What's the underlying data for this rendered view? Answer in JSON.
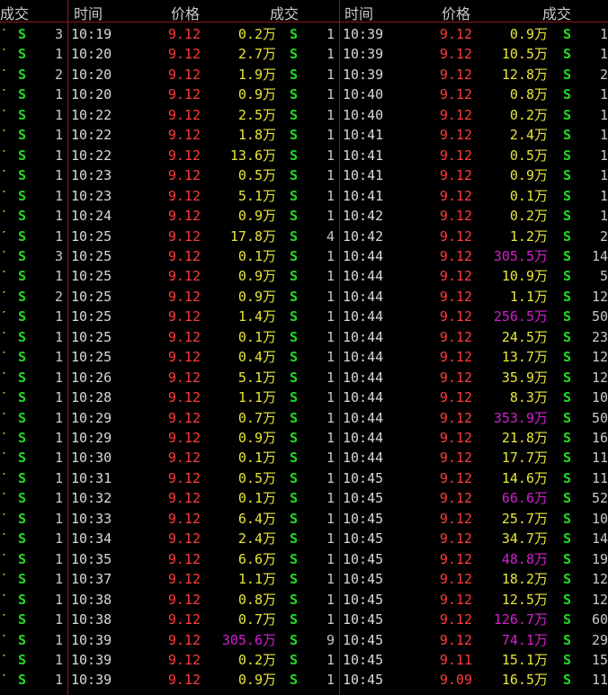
{
  "header": {
    "col0_trade": "成交",
    "left": {
      "time": "时间",
      "price": "价格",
      "trade": "成交"
    },
    "right": {
      "time": "时间",
      "price": "价格",
      "trade": "成交"
    }
  },
  "col0": [
    {
      "n": "3"
    },
    {
      "n": "1"
    },
    {
      "n": "2"
    },
    {
      "n": "1"
    },
    {
      "n": "1"
    },
    {
      "n": "1"
    },
    {
      "n": "1"
    },
    {
      "n": "1"
    },
    {
      "n": "1"
    },
    {
      "n": "1"
    },
    {
      "n": "1"
    },
    {
      "n": "3"
    },
    {
      "n": "1"
    },
    {
      "n": "2"
    },
    {
      "n": "1"
    },
    {
      "n": "1"
    },
    {
      "n": "1"
    },
    {
      "n": "1"
    },
    {
      "n": "1"
    },
    {
      "n": "1"
    },
    {
      "n": "1"
    },
    {
      "n": "1"
    },
    {
      "n": "1"
    },
    {
      "n": "1"
    },
    {
      "n": "1"
    },
    {
      "n": "1"
    },
    {
      "n": "1"
    },
    {
      "n": "1"
    },
    {
      "n": "1"
    },
    {
      "n": "1"
    },
    {
      "n": "1"
    },
    {
      "n": "1"
    },
    {
      "n": "1"
    }
  ],
  "left": [
    {
      "time": "10:19",
      "price": "9.12",
      "vol": "0.2万",
      "s": "S",
      "n": "1"
    },
    {
      "time": "10:20",
      "price": "9.12",
      "vol": "2.7万",
      "s": "S",
      "n": "1"
    },
    {
      "time": "10:20",
      "price": "9.12",
      "vol": "1.9万",
      "s": "S",
      "n": "1"
    },
    {
      "time": "10:20",
      "price": "9.12",
      "vol": "0.9万",
      "s": "S",
      "n": "1"
    },
    {
      "time": "10:22",
      "price": "9.12",
      "vol": "2.5万",
      "s": "S",
      "n": "1"
    },
    {
      "time": "10:22",
      "price": "9.12",
      "vol": "1.8万",
      "s": "S",
      "n": "1"
    },
    {
      "time": "10:22",
      "price": "9.12",
      "vol": "13.6万",
      "s": "S",
      "n": "1"
    },
    {
      "time": "10:23",
      "price": "9.12",
      "vol": "0.5万",
      "s": "S",
      "n": "1"
    },
    {
      "time": "10:23",
      "price": "9.12",
      "vol": "5.1万",
      "s": "S",
      "n": "1"
    },
    {
      "time": "10:24",
      "price": "9.12",
      "vol": "0.9万",
      "s": "S",
      "n": "1"
    },
    {
      "time": "10:25",
      "price": "9.12",
      "vol": "17.8万",
      "s": "S",
      "n": "4"
    },
    {
      "time": "10:25",
      "price": "9.12",
      "vol": "0.1万",
      "s": "S",
      "n": "1"
    },
    {
      "time": "10:25",
      "price": "9.12",
      "vol": "0.9万",
      "s": "S",
      "n": "1"
    },
    {
      "time": "10:25",
      "price": "9.12",
      "vol": "0.9万",
      "s": "S",
      "n": "1"
    },
    {
      "time": "10:25",
      "price": "9.12",
      "vol": "1.4万",
      "s": "S",
      "n": "1"
    },
    {
      "time": "10:25",
      "price": "9.12",
      "vol": "0.1万",
      "s": "S",
      "n": "1"
    },
    {
      "time": "10:25",
      "price": "9.12",
      "vol": "0.4万",
      "s": "S",
      "n": "1"
    },
    {
      "time": "10:26",
      "price": "9.12",
      "vol": "5.1万",
      "s": "S",
      "n": "1"
    },
    {
      "time": "10:28",
      "price": "9.12",
      "vol": "1.1万",
      "s": "S",
      "n": "1"
    },
    {
      "time": "10:29",
      "price": "9.12",
      "vol": "0.7万",
      "s": "S",
      "n": "1"
    },
    {
      "time": "10:29",
      "price": "9.12",
      "vol": "0.9万",
      "s": "S",
      "n": "1"
    },
    {
      "time": "10:30",
      "price": "9.12",
      "vol": "0.1万",
      "s": "S",
      "n": "1"
    },
    {
      "time": "10:31",
      "price": "9.12",
      "vol": "0.5万",
      "s": "S",
      "n": "1"
    },
    {
      "time": "10:32",
      "price": "9.12",
      "vol": "0.1万",
      "s": "S",
      "n": "1"
    },
    {
      "time": "10:33",
      "price": "9.12",
      "vol": "6.4万",
      "s": "S",
      "n": "1"
    },
    {
      "time": "10:34",
      "price": "9.12",
      "vol": "2.4万",
      "s": "S",
      "n": "1"
    },
    {
      "time": "10:35",
      "price": "9.12",
      "vol": "6.6万",
      "s": "S",
      "n": "1"
    },
    {
      "time": "10:37",
      "price": "9.12",
      "vol": "1.1万",
      "s": "S",
      "n": "1"
    },
    {
      "time": "10:38",
      "price": "9.12",
      "vol": "0.8万",
      "s": "S",
      "n": "1"
    },
    {
      "time": "10:38",
      "price": "9.12",
      "vol": "0.7万",
      "s": "S",
      "n": "1"
    },
    {
      "time": "10:39",
      "price": "9.12",
      "vol": "305.6万",
      "s": "S",
      "n": "9",
      "big": true
    },
    {
      "time": "10:39",
      "price": "9.12",
      "vol": "0.2万",
      "s": "S",
      "n": "1"
    },
    {
      "time": "10:39",
      "price": "9.12",
      "vol": "0.9万",
      "s": "S",
      "n": "1"
    }
  ],
  "right": [
    {
      "time": "10:39",
      "price": "9.12",
      "vol": "0.9万",
      "s": "S",
      "n": "1"
    },
    {
      "time": "10:39",
      "price": "9.12",
      "vol": "10.5万",
      "s": "S",
      "n": "1"
    },
    {
      "time": "10:39",
      "price": "9.12",
      "vol": "12.8万",
      "s": "S",
      "n": "2"
    },
    {
      "time": "10:40",
      "price": "9.12",
      "vol": "0.8万",
      "s": "S",
      "n": "1"
    },
    {
      "time": "10:40",
      "price": "9.12",
      "vol": "0.2万",
      "s": "S",
      "n": "1"
    },
    {
      "time": "10:41",
      "price": "9.12",
      "vol": "2.4万",
      "s": "S",
      "n": "1"
    },
    {
      "time": "10:41",
      "price": "9.12",
      "vol": "0.5万",
      "s": "S",
      "n": "1"
    },
    {
      "time": "10:41",
      "price": "9.12",
      "vol": "0.9万",
      "s": "S",
      "n": "1"
    },
    {
      "time": "10:41",
      "price": "9.12",
      "vol": "0.1万",
      "s": "S",
      "n": "1"
    },
    {
      "time": "10:42",
      "price": "9.12",
      "vol": "0.2万",
      "s": "S",
      "n": "1"
    },
    {
      "time": "10:42",
      "price": "9.12",
      "vol": "1.2万",
      "s": "S",
      "n": "2"
    },
    {
      "time": "10:44",
      "price": "9.12",
      "vol": "305.5万",
      "s": "S",
      "n": "14",
      "big": true
    },
    {
      "time": "10:44",
      "price": "9.12",
      "vol": "10.9万",
      "s": "S",
      "n": "5"
    },
    {
      "time": "10:44",
      "price": "9.12",
      "vol": "1.1万",
      "s": "S",
      "n": "12"
    },
    {
      "time": "10:44",
      "price": "9.12",
      "vol": "256.5万",
      "s": "S",
      "n": "50",
      "big": true
    },
    {
      "time": "10:44",
      "price": "9.12",
      "vol": "24.5万",
      "s": "S",
      "n": "23"
    },
    {
      "time": "10:44",
      "price": "9.12",
      "vol": "13.7万",
      "s": "S",
      "n": "12"
    },
    {
      "time": "10:44",
      "price": "9.12",
      "vol": "35.9万",
      "s": "S",
      "n": "12"
    },
    {
      "time": "10:44",
      "price": "9.12",
      "vol": "8.3万",
      "s": "S",
      "n": "10"
    },
    {
      "time": "10:44",
      "price": "9.12",
      "vol": "353.9万",
      "s": "S",
      "n": "50",
      "big": true
    },
    {
      "time": "10:44",
      "price": "9.12",
      "vol": "21.8万",
      "s": "S",
      "n": "16"
    },
    {
      "time": "10:44",
      "price": "9.12",
      "vol": "17.7万",
      "s": "S",
      "n": "11"
    },
    {
      "time": "10:45",
      "price": "9.12",
      "vol": "14.6万",
      "s": "S",
      "n": "11"
    },
    {
      "time": "10:45",
      "price": "9.12",
      "vol": "66.6万",
      "s": "S",
      "n": "52",
      "big": true
    },
    {
      "time": "10:45",
      "price": "9.12",
      "vol": "25.7万",
      "s": "S",
      "n": "10"
    },
    {
      "time": "10:45",
      "price": "9.12",
      "vol": "34.7万",
      "s": "S",
      "n": "14"
    },
    {
      "time": "10:45",
      "price": "9.12",
      "vol": "48.8万",
      "s": "S",
      "n": "19",
      "big": true
    },
    {
      "time": "10:45",
      "price": "9.12",
      "vol": "18.2万",
      "s": "S",
      "n": "12"
    },
    {
      "time": "10:45",
      "price": "9.12",
      "vol": "12.5万",
      "s": "S",
      "n": "12"
    },
    {
      "time": "10:45",
      "price": "9.12",
      "vol": "126.7万",
      "s": "S",
      "n": "60",
      "big": true
    },
    {
      "time": "10:45",
      "price": "9.12",
      "vol": "74.1万",
      "s": "S",
      "n": "29",
      "big": true
    },
    {
      "time": "10:45",
      "price": "9.11",
      "vol": "15.1万",
      "s": "S",
      "n": "15"
    },
    {
      "time": "10:45",
      "price": "9.09",
      "vol": "16.5万",
      "s": "S",
      "n": "11"
    }
  ]
}
